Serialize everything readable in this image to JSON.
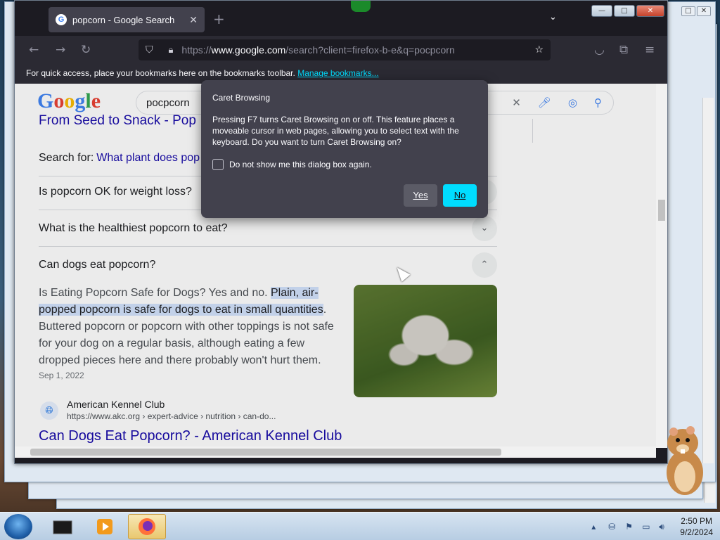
{
  "browser": {
    "tab_title": "popcorn - Google Search",
    "tab_favicon": "G",
    "tab_close": "✕",
    "new_tab": "+",
    "tab_list": "⌄",
    "url_prefix": "https://",
    "url_host": "www.google.com",
    "url_rest": "/search?client=firefox-b-e&q=pocpcorn",
    "bookmarks_text": "For quick access, place your bookmarks here on the bookmarks toolbar.",
    "bookmarks_link": "Manage bookmarks..."
  },
  "google": {
    "logo": "Google",
    "search_query": "pocpcorn",
    "partial_heading": "From Seed to Snack - Pop",
    "faqs": [
      {
        "prefix": "Search for:",
        "link": "What plant does pop"
      },
      {
        "question": "Is popcorn OK for weight loss?"
      },
      {
        "question": "What is the healthiest popcorn to eat?"
      },
      {
        "question": "Can dogs eat popcorn?"
      }
    ],
    "answer_plain_1": "Is Eating Popcorn Safe for Dogs? Yes and no. ",
    "answer_highlight": "Plain, air-popped popcorn is safe for dogs to eat in small quantities",
    "answer_plain_2": ". Buttered popcorn or popcorn with other toppings is not safe for your dog on a regular basis, although eating a few dropped pieces here and there probably won't hurt them.",
    "answer_date": "Sep 1, 2022",
    "source_name": "American Kennel Club",
    "source_url": "https://www.akc.org › expert-advice › nutrition › can-do...",
    "result_title": "Can Dogs Eat Popcorn? - American Kennel Club"
  },
  "dialog": {
    "title": "Caret Browsing",
    "message": "Pressing F7 turns Caret Browsing on or off. This feature places a moveable cursor in web pages, allowing you to select text with the keyboard. Do you want to turn Caret Browsing on?",
    "checkbox_label": "Do not show me this dialog box again.",
    "yes_label": "Yes",
    "no_label": "No"
  },
  "taskbar": {
    "time": "2:50 PM",
    "date": "9/2/2024"
  },
  "colors": {
    "accent": "#00ddff",
    "link": "#1a0dab"
  }
}
